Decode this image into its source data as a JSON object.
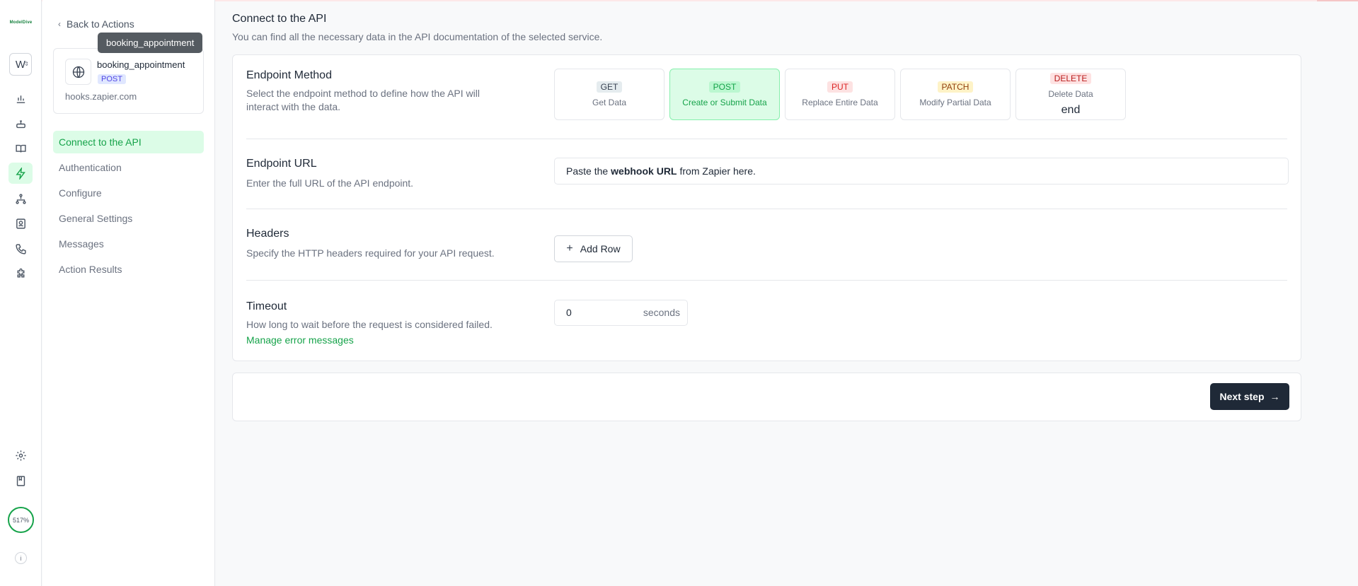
{
  "app": {
    "logo_text": "ModelDive",
    "workspace_initial": "W",
    "credits_label": "517%",
    "info_label": "i"
  },
  "rail_icons": [
    {
      "name": "analytics-icon"
    },
    {
      "name": "bot-icon"
    },
    {
      "name": "knowledge-book-icon"
    },
    {
      "name": "actions-bolt-icon",
      "active": true
    },
    {
      "name": "workflow-icon"
    },
    {
      "name": "contacts-icon"
    },
    {
      "name": "phone-icon"
    },
    {
      "name": "integrations-puzzle-icon"
    },
    {
      "name": "settings-gear-icon"
    },
    {
      "name": "docs-book-icon"
    }
  ],
  "sidebar": {
    "back_label": "Back to Actions",
    "tooltip": "booking_appointment",
    "action": {
      "name": "booking_appointment",
      "method": "POST",
      "host": "hooks.zapier.com"
    },
    "nav": [
      {
        "label": "Connect to the API",
        "active": true
      },
      {
        "label": "Authentication"
      },
      {
        "label": "Configure"
      },
      {
        "label": "General Settings"
      },
      {
        "label": "Messages"
      },
      {
        "label": "Action Results"
      }
    ]
  },
  "main": {
    "title": "Connect to the API",
    "subtitle": "You can find all the necessary data in the API documentation of the selected service.",
    "endpoint_method": {
      "label": "Endpoint Method",
      "description": "Select the endpoint method to define how the API will interact with the data.",
      "options": [
        {
          "tag": "GET",
          "desc": "Get Data",
          "tag_bg": "#e5ecef",
          "tag_color": "#374151"
        },
        {
          "tag": "POST",
          "desc": "Create or Submit Data",
          "selected": true,
          "tag_bg": "#bbf7d0",
          "tag_color": "#16a34a"
        },
        {
          "tag": "PUT",
          "desc": "Replace Entire Data",
          "tag_bg": "#fde2e2",
          "tag_color": "#dc2626"
        },
        {
          "tag": "PATCH",
          "desc": "Modify Partial Data",
          "tag_bg": "#fef3c7",
          "tag_color": "#92400e"
        },
        {
          "tag": "DELETE",
          "desc": "Delete Data",
          "tag_bg": "#fee2e2",
          "tag_color": "#b91c1c"
        }
      ]
    },
    "endpoint_url": {
      "label": "Endpoint URL",
      "description": "Enter the full URL of the API endpoint.",
      "placeholder_pre": "Paste the",
      "placeholder_bold": "webhook URL",
      "placeholder_post": "from Zapier here."
    },
    "headers": {
      "label": "Headers",
      "description": "Specify the HTTP headers required for your API request.",
      "add_row_label": "Add Row"
    },
    "timeout": {
      "label": "Timeout",
      "description": "How long to wait before the request is considered failed.",
      "value": "0",
      "unit": "seconds",
      "link_label": "Manage error messages"
    },
    "next_label": "Next step"
  }
}
